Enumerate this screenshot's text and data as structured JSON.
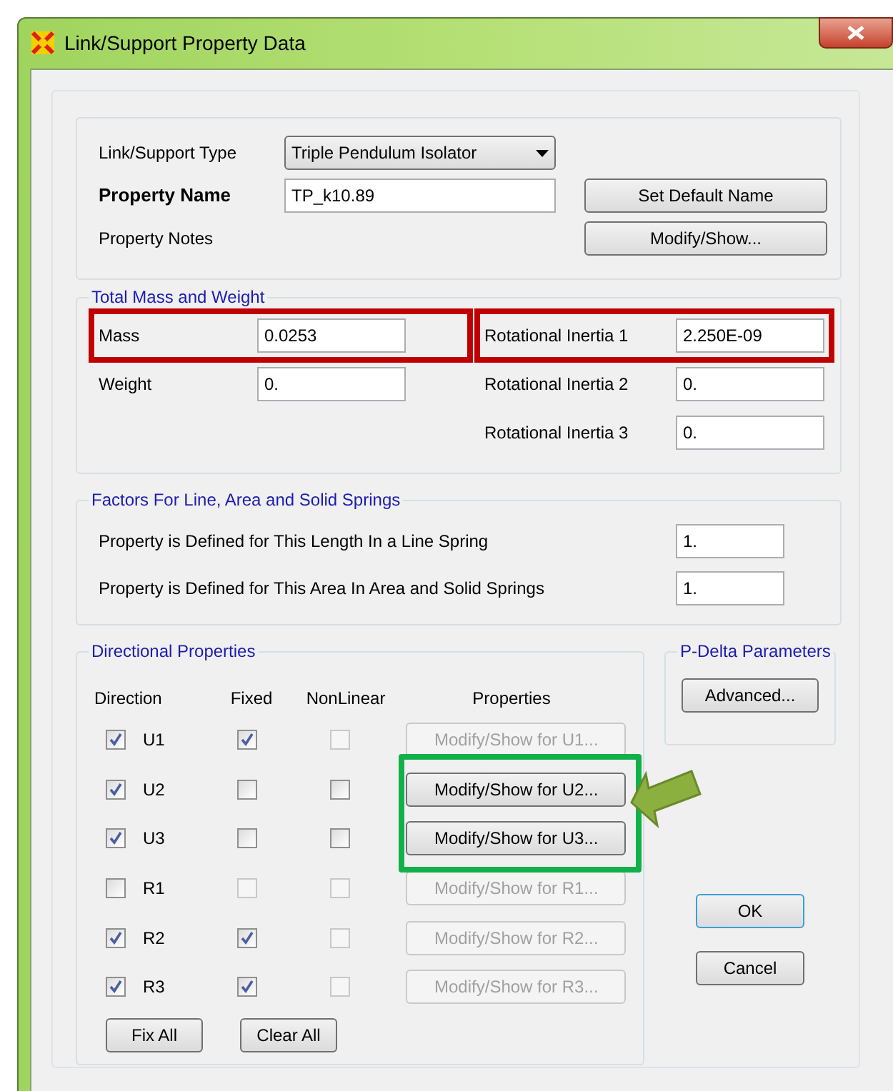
{
  "window": {
    "title": "Link/Support Property Data"
  },
  "header": {
    "type_label": "Link/Support Type",
    "type_value": "Triple Pendulum Isolator",
    "name_label": "Property Name",
    "name_value": "TP_k10.89",
    "default_button": "Set Default Name",
    "notes_label": "Property Notes",
    "notes_button": "Modify/Show..."
  },
  "mass_weight": {
    "title": "Total Mass and Weight",
    "left": [
      {
        "label": "Mass",
        "value": "0.0253",
        "highlighted": true
      },
      {
        "label": "Weight",
        "value": "0.",
        "highlighted": false
      }
    ],
    "right": [
      {
        "label": "Rotational Inertia 1",
        "value": "2.250E-09",
        "highlighted": true
      },
      {
        "label": "Rotational Inertia 2",
        "value": "0.",
        "highlighted": false
      },
      {
        "label": "Rotational Inertia 3",
        "value": "0.",
        "highlighted": false
      }
    ]
  },
  "factors": {
    "title": "Factors For Line, Area and Solid Springs",
    "rows": [
      {
        "label": "Property is Defined for This Length In a Line Spring",
        "value": "1."
      },
      {
        "label": "Property is Defined for This Area In Area and Solid Springs",
        "value": "1."
      }
    ]
  },
  "directional": {
    "title": "Directional Properties",
    "columns": [
      "Direction",
      "Fixed",
      "NonLinear",
      "Properties"
    ],
    "rows": [
      {
        "direction": "U1",
        "checked": true,
        "fixed": {
          "checked": true,
          "disabled": false
        },
        "nonlinear": {
          "checked": false,
          "disabled": true
        },
        "button": {
          "label": "Modify/Show for U1...",
          "disabled": true,
          "highlighted": false
        }
      },
      {
        "direction": "U2",
        "checked": true,
        "fixed": {
          "checked": false,
          "disabled": false
        },
        "nonlinear": {
          "checked": false,
          "disabled": false
        },
        "button": {
          "label": "Modify/Show for U2...",
          "disabled": false,
          "highlighted": true
        }
      },
      {
        "direction": "U3",
        "checked": true,
        "fixed": {
          "checked": false,
          "disabled": false
        },
        "nonlinear": {
          "checked": false,
          "disabled": false
        },
        "button": {
          "label": "Modify/Show for U3...",
          "disabled": false,
          "highlighted": true
        }
      },
      {
        "direction": "R1",
        "checked": false,
        "fixed": {
          "checked": false,
          "disabled": true
        },
        "nonlinear": {
          "checked": false,
          "disabled": true
        },
        "button": {
          "label": "Modify/Show for R1...",
          "disabled": true,
          "highlighted": false
        }
      },
      {
        "direction": "R2",
        "checked": true,
        "fixed": {
          "checked": true,
          "disabled": false
        },
        "nonlinear": {
          "checked": false,
          "disabled": true
        },
        "button": {
          "label": "Modify/Show for R2...",
          "disabled": true,
          "highlighted": false
        }
      },
      {
        "direction": "R3",
        "checked": true,
        "fixed": {
          "checked": true,
          "disabled": false
        },
        "nonlinear": {
          "checked": false,
          "disabled": true
        },
        "button": {
          "label": "Modify/Show for R3...",
          "disabled": true,
          "highlighted": false
        }
      }
    ],
    "buttons": [
      "Fix All",
      "Clear All"
    ]
  },
  "pdelta": {
    "title": "P-Delta Parameters",
    "button": "Advanced..."
  },
  "buttons": {
    "ok": "OK",
    "cancel": "Cancel"
  }
}
